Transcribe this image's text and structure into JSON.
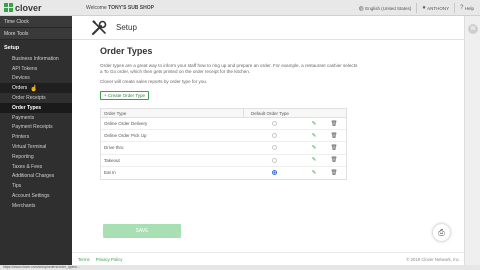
{
  "topbar": {
    "logo_text": "clover",
    "welcome_prefix": "Welcome",
    "merchant_name": "TONY'S SUB SHOP",
    "language": "English (United States)",
    "user": "ANTHONY",
    "help": "Help"
  },
  "sidebar": {
    "top_items": [
      {
        "label": "Time Clock"
      },
      {
        "label": "More Tools"
      }
    ],
    "section_title": "Setup",
    "items": [
      {
        "label": "Business Information",
        "state": "normal"
      },
      {
        "label": "API Tokens",
        "state": "normal"
      },
      {
        "label": "Devices",
        "state": "normal"
      },
      {
        "label": "Orders",
        "state": "hover"
      },
      {
        "label": "Order Receipts",
        "state": "normal"
      },
      {
        "label": "Order Types",
        "state": "active"
      },
      {
        "label": "Payments",
        "state": "normal"
      },
      {
        "label": "Payment Receipts",
        "state": "normal"
      },
      {
        "label": "Printers",
        "state": "normal"
      },
      {
        "label": "Virtual Terminal",
        "state": "normal"
      },
      {
        "label": "Reporting",
        "state": "normal"
      },
      {
        "label": "Taxes & Fees",
        "state": "normal"
      },
      {
        "label": "Additional Charges",
        "state": "normal"
      },
      {
        "label": "Tips",
        "state": "normal"
      },
      {
        "label": "Account Settings",
        "state": "normal"
      },
      {
        "label": "Merchants",
        "state": "normal"
      }
    ]
  },
  "header": {
    "title": "Setup",
    "icon": "tools-icon"
  },
  "main": {
    "page_title": "Order Types",
    "description": "Order types are a great way to inform your staff how to ring up and prepare an order. For example, a restaurant cashier selects a To Go order, which then gets printed on the order receipt for the kitchen.",
    "description2": "Clover will create sales reports by order type for you.",
    "create_button": "+ Create Order Type",
    "table": {
      "col_type": "Order Type",
      "col_default": "Default Order Type",
      "rows": [
        {
          "name": "Online Order Delivery",
          "default": false
        },
        {
          "name": "Online Order Pick Up",
          "default": false
        },
        {
          "name": "Drive thru",
          "default": false
        },
        {
          "name": "Takeout",
          "default": false
        },
        {
          "name": "Eat In",
          "default": true
        }
      ]
    },
    "save_button": "SAVE"
  },
  "footer": {
    "terms": "Terms",
    "privacy": "Privacy Policy",
    "copyright": "© 2019 Clover Network, Inc."
  },
  "gutter": {
    "avatar_letter": "W"
  },
  "statusbar": {
    "url": "https://www.clover.com/setup/orders/order_types/..."
  },
  "colors": {
    "brand_green": "#3aa14a",
    "sidebar_bg": "#2f2f2f",
    "save_disabled": "#a8e0b4",
    "radio_selected": "#2f6fcf"
  }
}
